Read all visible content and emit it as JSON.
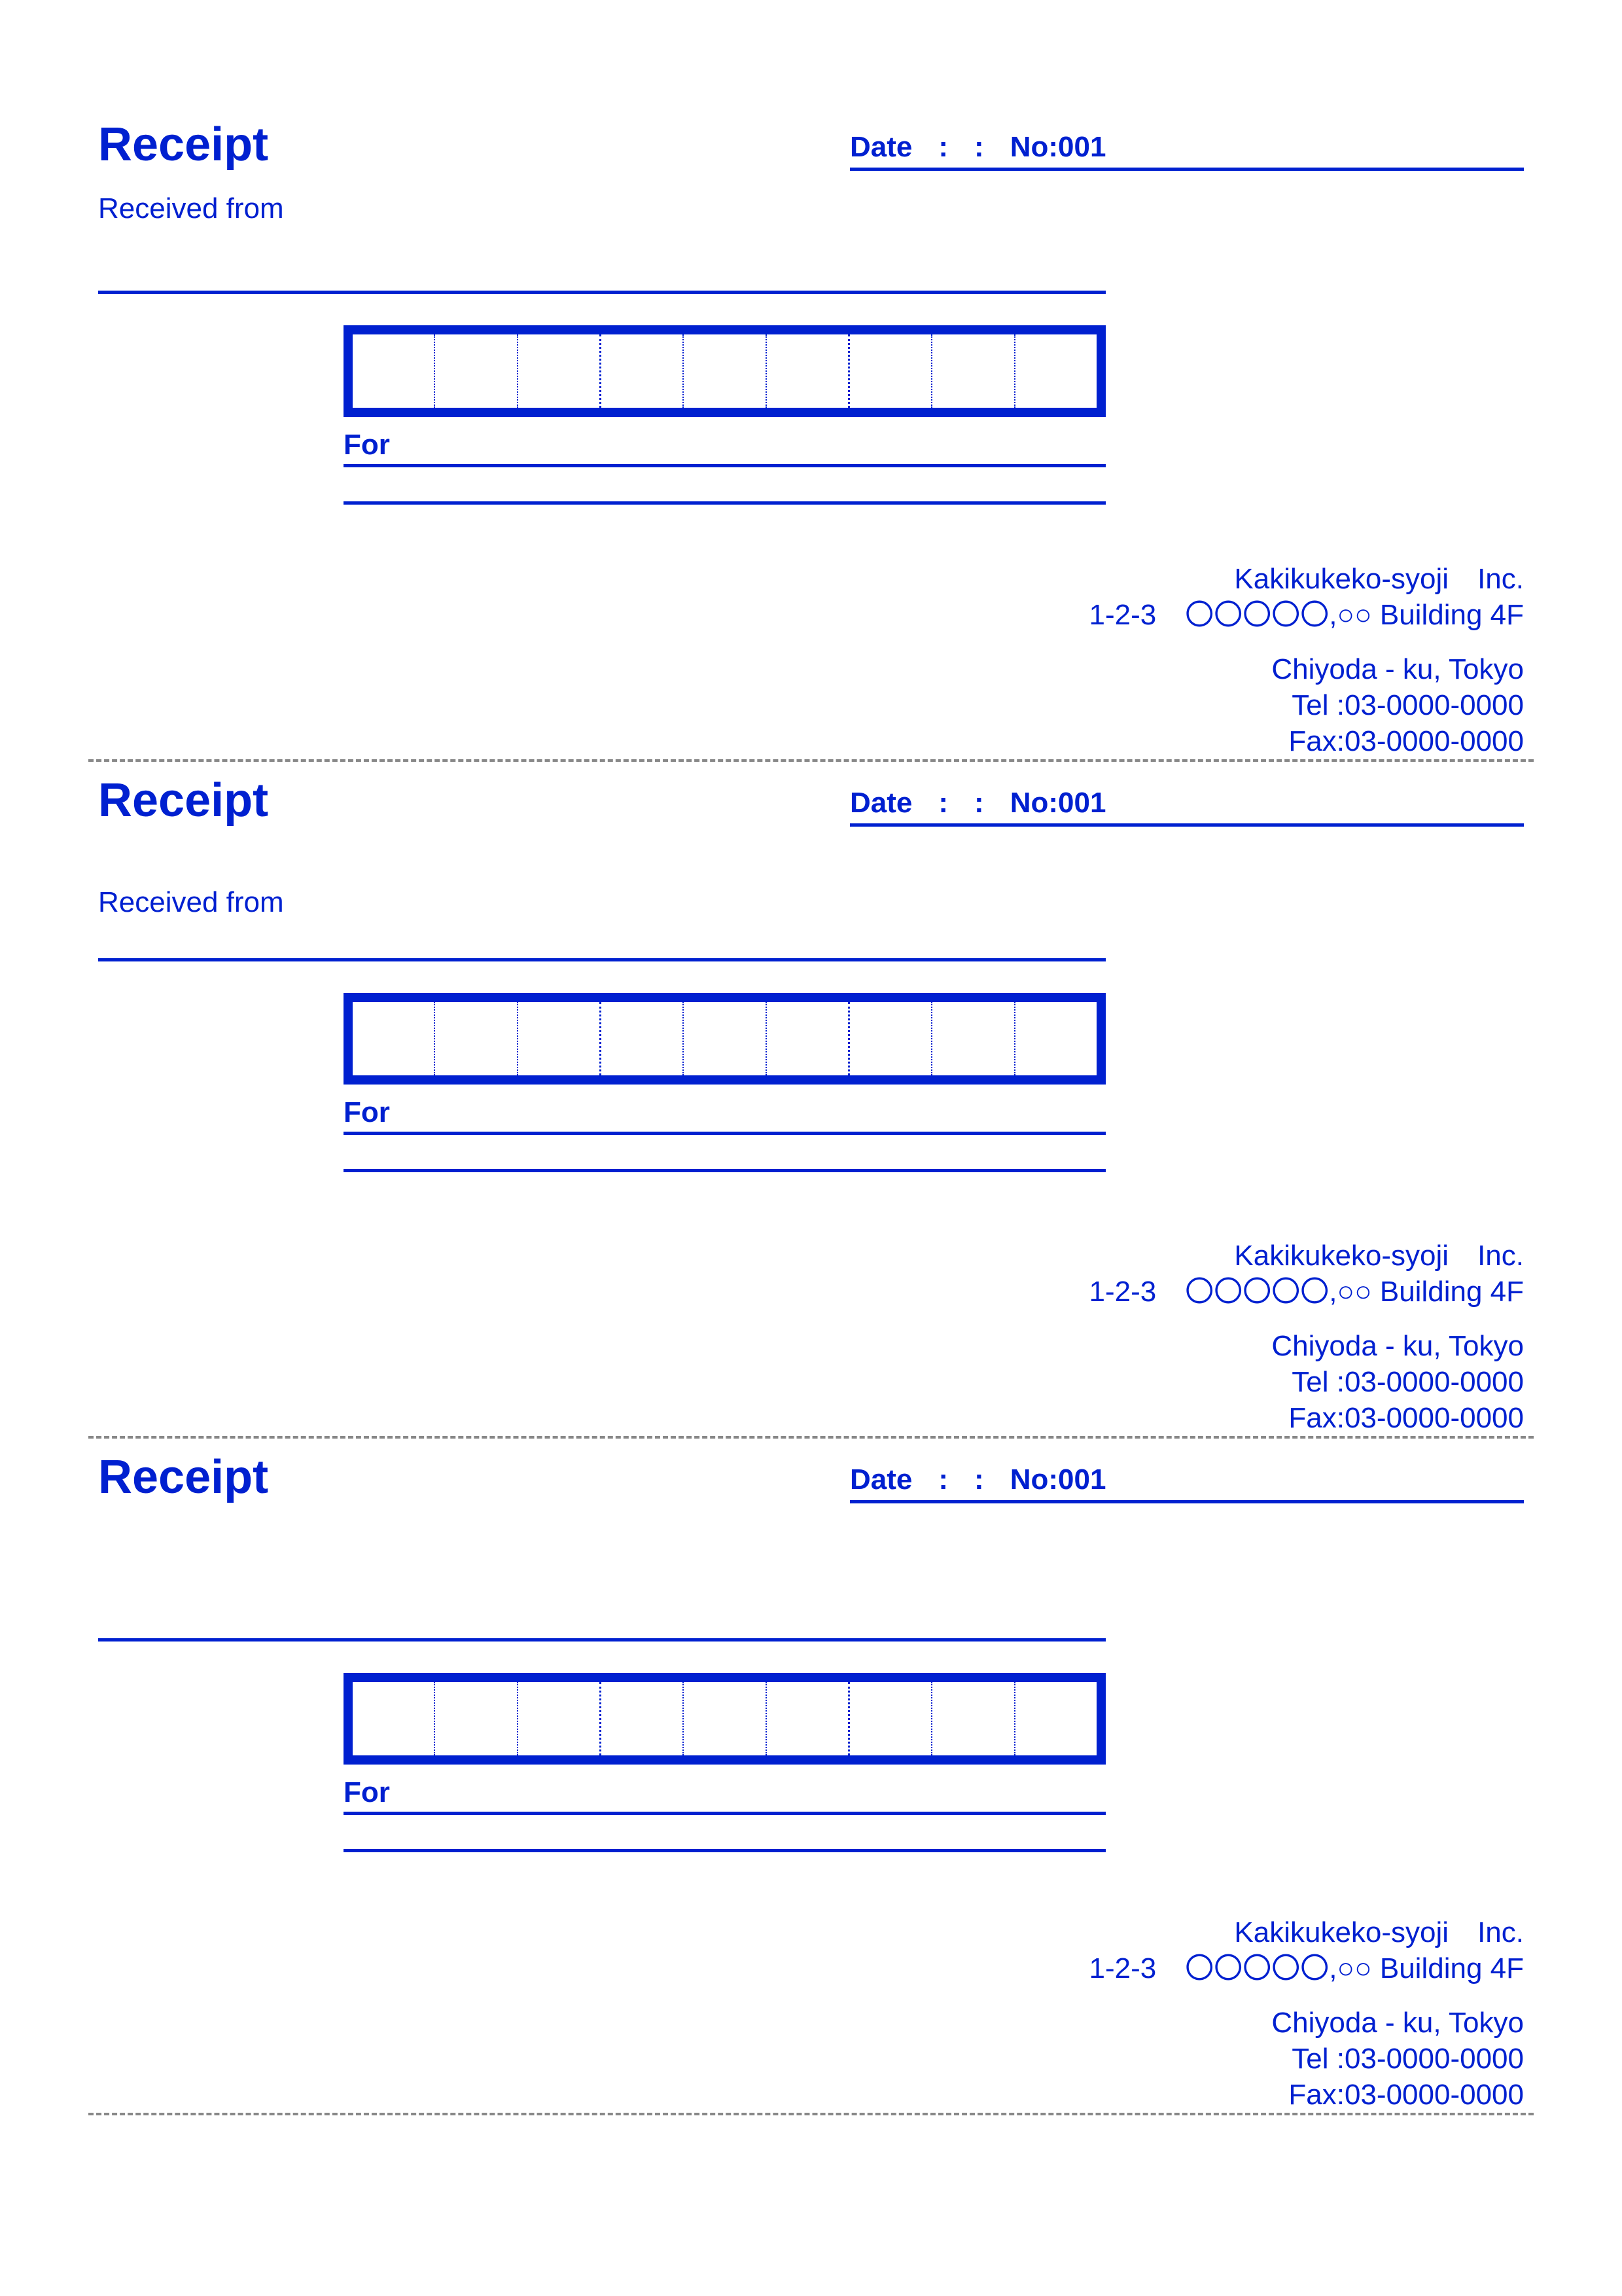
{
  "title": "Receipt",
  "date_label": "Date",
  "date_sep": ":",
  "no_label": "No:",
  "no_value": "001",
  "received_label": "Received from",
  "for_label": "For",
  "company": {
    "name": "Kakikukeko-syoji　Inc.",
    "addr1": "1-2-3　〇〇〇〇〇,○○ Building 4F",
    "addr2": "Chiyoda - ku, Tokyo",
    "tel": "Tel :03-0000-0000",
    "fax": "Fax:03-0000-0000"
  }
}
